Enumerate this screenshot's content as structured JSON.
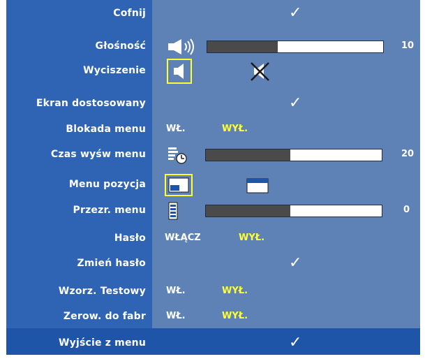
{
  "menu": {
    "rows": [
      {
        "label": "Cofnij",
        "type": "check"
      },
      {
        "label": "Głośność",
        "type": "slider",
        "value": "10",
        "fill": 0.4
      },
      {
        "label": "Wyciszenie",
        "type": "mute"
      },
      {
        "label": "Ekran dostosowany",
        "type": "check"
      },
      {
        "label": "Blokada menu",
        "on": "WŁ.",
        "off": "WYŁ."
      },
      {
        "label": "Czas wyśw menu",
        "type": "slider",
        "value": "20",
        "fill": 0.48
      },
      {
        "label": "Menu pozycja",
        "type": "position"
      },
      {
        "label": "Przezr. menu",
        "type": "slider",
        "value": "0",
        "fill": 0.48
      },
      {
        "label": "Hasło",
        "on": "WŁĄCZ",
        "off": "WYŁ."
      },
      {
        "label": "Zmień hasło",
        "type": "check"
      },
      {
        "label": "Wzorz. Testowy",
        "on": "WŁ.",
        "off": "WYŁ."
      },
      {
        "label": "Zerow. do fabr",
        "on": "WŁ.",
        "off": "WYŁ."
      }
    ],
    "exit": {
      "label": "Wyjście z menu",
      "type": "check"
    }
  },
  "icons": {
    "volume": "speaker-waves-icon",
    "mute_on": "speaker-icon",
    "mute_off": "speaker-crossed-icon",
    "timer": "menu-clock-icon",
    "position_left": "menu-position-bottom-left-icon",
    "position_center": "menu-position-top-icon",
    "transparency": "transparency-icon"
  },
  "colors": {
    "left_panel": "#2f63b3",
    "right_panel": "#5f82b6",
    "exit_bar": "#1f55a8",
    "highlight": "#ffff33",
    "text": "#ffffff"
  }
}
